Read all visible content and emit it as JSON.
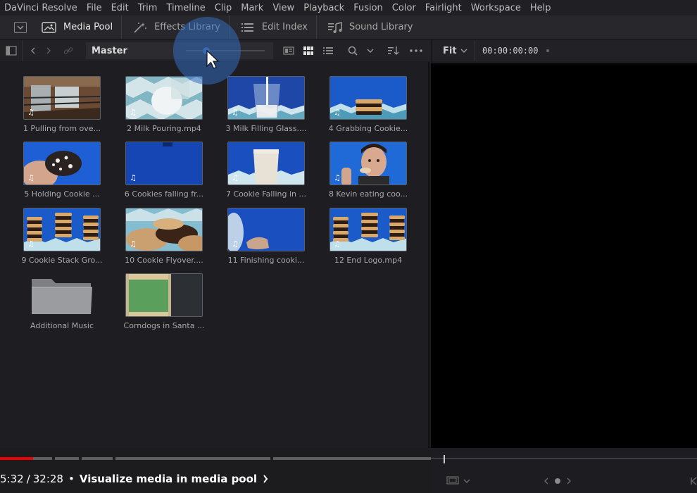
{
  "menubar": {
    "items": [
      "DaVinci Resolve",
      "File",
      "Edit",
      "Trim",
      "Timeline",
      "Clip",
      "Mark",
      "View",
      "Playback",
      "Fusion",
      "Color",
      "Fairlight",
      "Workspace",
      "Help"
    ]
  },
  "toolbar": {
    "media_pool": "Media Pool",
    "effects_library": "Effects Library",
    "edit_index": "Edit Index",
    "sound_library": "Sound Library"
  },
  "subbar": {
    "bin_name": "Master",
    "fit_label": "Fit",
    "timecode": "00:00:00:00"
  },
  "clips": [
    {
      "name": "1 Pulling from ove...",
      "thumb": "oven",
      "audio": true
    },
    {
      "name": "2 Milk Pouring.mp4",
      "thumb": "milk-pour",
      "audio": true
    },
    {
      "name": "3 Milk Filling Glass....",
      "thumb": "glass-fill",
      "audio": true
    },
    {
      "name": "4 Grabbing Cookie...",
      "thumb": "cookie-stack",
      "audio": true
    },
    {
      "name": "5 Holding Cookie ...",
      "thumb": "hand-cookie",
      "audio": true
    },
    {
      "name": "6 Cookies falling fr...",
      "thumb": "blue",
      "audio": true
    },
    {
      "name": "7 Cookie Falling in ...",
      "thumb": "milk-glass",
      "audio": true
    },
    {
      "name": "8 Kevin eating coo...",
      "thumb": "person",
      "audio": true
    },
    {
      "name": "9 Cookie Stack Gro...",
      "thumb": "stacks",
      "audio": true
    },
    {
      "name": "10 Cookie Flyover....",
      "thumb": "flyover",
      "audio": true
    },
    {
      "name": "11 Finishing cooki...",
      "thumb": "finish",
      "audio": true
    },
    {
      "name": "12 End Logo.mp4",
      "thumb": "stacks",
      "audio": true
    },
    {
      "name": "Additional Music",
      "thumb": "folder",
      "audio": false
    },
    {
      "name": "Corndogs in Santa ...",
      "thumb": "audio",
      "audio": false
    }
  ],
  "icons": {
    "audio": "♫"
  },
  "video_player": {
    "current_time": "5:32",
    "total_time": "32:28",
    "separator": "•",
    "chapter": "Visualize media in media pool",
    "progress_fraction": 0.17
  },
  "colors": {
    "accent_blue": "#3a66a8",
    "yt_red": "#e00000"
  }
}
